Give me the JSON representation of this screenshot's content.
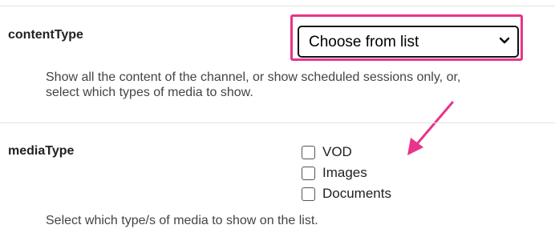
{
  "content_type": {
    "label": "contentType",
    "select_value": "Choose from list",
    "description": "Show all the content of the channel, or show scheduled sessions only, or, select which types of media to show."
  },
  "media_type": {
    "label": "mediaType",
    "options": [
      {
        "label": "VOD",
        "checked": false
      },
      {
        "label": "Images",
        "checked": false
      },
      {
        "label": "Documents",
        "checked": false
      }
    ],
    "description": "Select which type/s of media to show on the list."
  },
  "colors": {
    "highlight": "#e8348a",
    "text": "#333333",
    "divider": "#e2e2e2"
  },
  "icons": {
    "select_chevron": "chevron-down-icon",
    "annotation": "arrow-icon"
  }
}
